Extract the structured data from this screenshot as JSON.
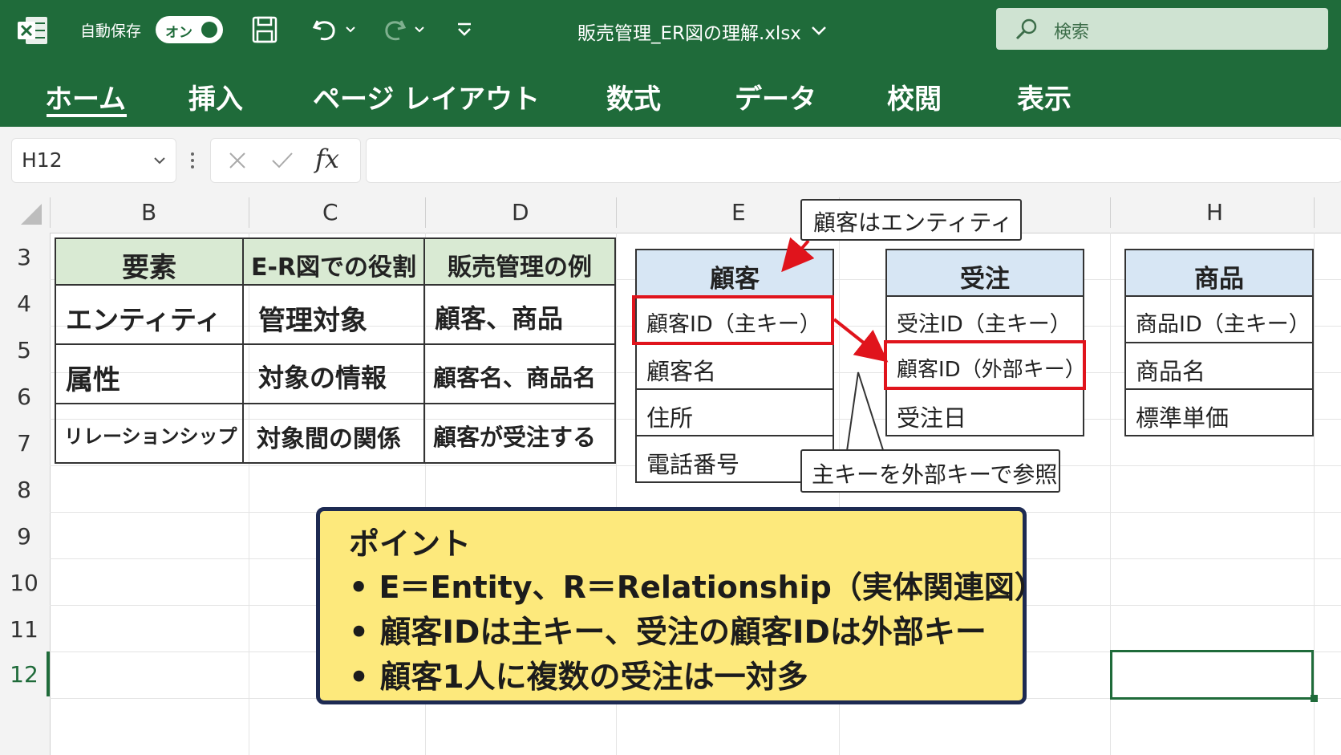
{
  "titlebar": {
    "autosave_label": "自動保存",
    "autosave_state": "オン",
    "file_title": "販売管理_ER図の理解.xlsx",
    "search_placeholder": "検索"
  },
  "ribbon": {
    "tabs": [
      {
        "label": "ホーム",
        "active": true
      },
      {
        "label": "挿入"
      },
      {
        "label": "ページ レイアウト"
      },
      {
        "label": "数式"
      },
      {
        "label": "データ"
      },
      {
        "label": "校閲"
      },
      {
        "label": "表示"
      }
    ]
  },
  "formula_bar": {
    "name_box": "H12",
    "fx_label": "fx",
    "value": ""
  },
  "columns": [
    "B",
    "C",
    "D",
    "E",
    "H"
  ],
  "rows": [
    "3",
    "4",
    "5",
    "6",
    "7",
    "8",
    "9",
    "10",
    "11",
    "12"
  ],
  "summary_table": {
    "headers": [
      "要素",
      "E-R図での役割",
      "販売管理の例"
    ],
    "rows": [
      [
        "エンティティ",
        "管理対象",
        "顧客、商品"
      ],
      [
        "属性",
        "対象の情報",
        "顧客名、商品名"
      ],
      [
        "リレーションシップ",
        "対象間の関係",
        "顧客が受注する"
      ]
    ]
  },
  "entities": [
    {
      "title": "顧客",
      "fields": [
        "顧客ID（主キー）",
        "顧客名",
        "住所",
        "電話番号"
      ]
    },
    {
      "title": "受注",
      "fields": [
        "受注ID（主キー）",
        "顧客ID（外部キー）",
        "受注日"
      ]
    },
    {
      "title": "商品",
      "fields": [
        "商品ID（主キー）",
        "商品名",
        "標準単価"
      ]
    }
  ],
  "callouts": {
    "entity_note": "顧客はエンティティ",
    "fk_note": "主キーを外部キーで参照"
  },
  "point_box": {
    "title": "ポイント",
    "lines": [
      "• E＝Entity、R＝Relationship（実体関連図）",
      "• 顧客IDは主キー、受注の顧客IDは外部キー",
      "• 顧客1人に複数の受注は一対多"
    ]
  },
  "colors": {
    "excel_green": "#1f6b3a",
    "header_green": "#d9ead3",
    "entity_blue": "#d7e6f4",
    "highlight_red": "#e0141c",
    "note_yellow": "#fde97c",
    "note_border": "#1d2a52"
  }
}
